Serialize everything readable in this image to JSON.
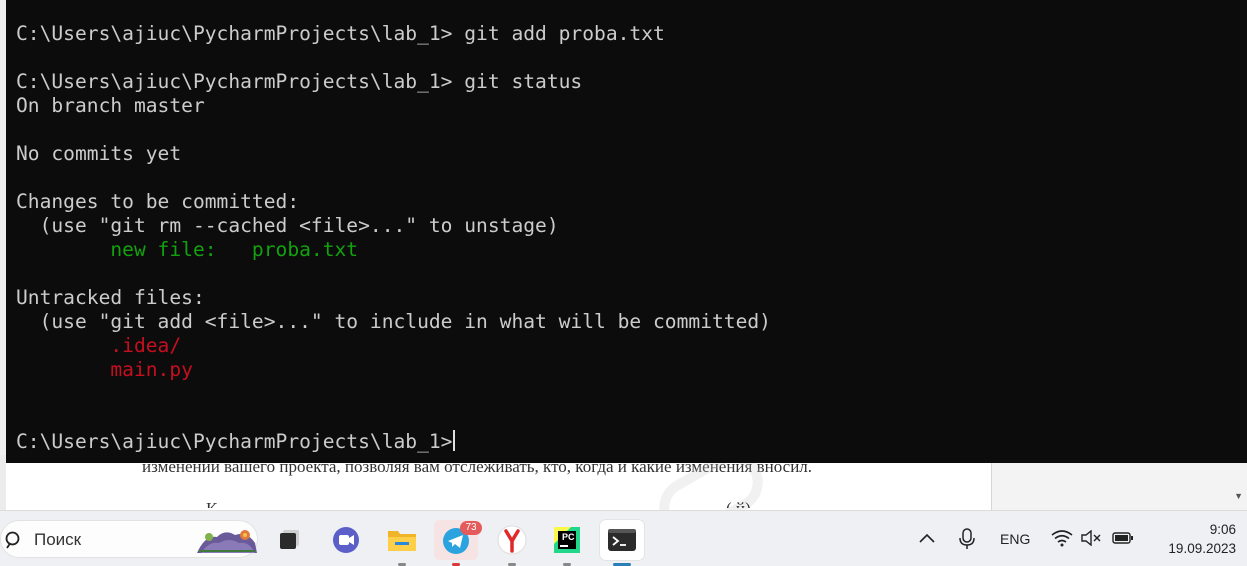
{
  "console": {
    "lines": [
      {
        "parts": [
          {
            "text": "C:\\Users\\ajiuc\\PycharmProjects\\lab_1> git add proba.txt"
          }
        ]
      },
      {
        "parts": [
          {
            "text": ""
          }
        ]
      },
      {
        "parts": [
          {
            "text": "C:\\Users\\ajiuc\\PycharmProjects\\lab_1> git status"
          }
        ]
      },
      {
        "parts": [
          {
            "text": "On branch master"
          }
        ]
      },
      {
        "parts": [
          {
            "text": ""
          }
        ]
      },
      {
        "parts": [
          {
            "text": "No commits yet"
          }
        ]
      },
      {
        "parts": [
          {
            "text": ""
          }
        ]
      },
      {
        "parts": [
          {
            "text": "Changes to be committed:"
          }
        ]
      },
      {
        "parts": [
          {
            "text": "  (use \"git rm --cached <file>...\" to unstage)"
          }
        ]
      },
      {
        "parts": [
          {
            "text": "        "
          },
          {
            "text": "new file:   proba.txt",
            "color": "green"
          }
        ]
      },
      {
        "parts": [
          {
            "text": ""
          }
        ]
      },
      {
        "parts": [
          {
            "text": "Untracked files:"
          }
        ]
      },
      {
        "parts": [
          {
            "text": "  (use \"git add <file>...\" to include in what will be committed)"
          }
        ]
      },
      {
        "parts": [
          {
            "text": "        "
          },
          {
            "text": ".idea/",
            "color": "red"
          }
        ]
      },
      {
        "parts": [
          {
            "text": "        "
          },
          {
            "text": "main.py",
            "color": "red"
          }
        ]
      },
      {
        "parts": [
          {
            "text": ""
          }
        ]
      },
      {
        "parts": [
          {
            "text": ""
          }
        ]
      }
    ],
    "prompt": "C:\\Users\\ajiuc\\PycharmProjects\\lab_1>",
    "colors": {
      "background": "#0c0c0c",
      "text": "#cccccc",
      "green": "#13a10e",
      "red": "#c50f1f"
    }
  },
  "document": {
    "line1": "изменений вашего проекта, позволяя вам отслеживать, кто, когда и какие изменения вносил.",
    "line2": "К",
    "line3": "(                    й)"
  },
  "taskbar": {
    "search_placeholder": "Поиск",
    "apps": [
      {
        "name": "task-view",
        "icon": "task-view-icon"
      },
      {
        "name": "chat",
        "icon": "chat-icon"
      },
      {
        "name": "file-explorer",
        "icon": "folder-icon"
      },
      {
        "name": "telegram",
        "icon": "telegram-icon",
        "badge": "73"
      },
      {
        "name": "yandex-browser",
        "icon": "yandex-icon"
      },
      {
        "name": "pycharm",
        "icon": "pycharm-icon",
        "label": "PC"
      },
      {
        "name": "terminal",
        "icon": "terminal-icon",
        "active": true
      }
    ],
    "tray": {
      "language": "ENG",
      "time": "9:06",
      "date": "19.09.2023"
    }
  }
}
